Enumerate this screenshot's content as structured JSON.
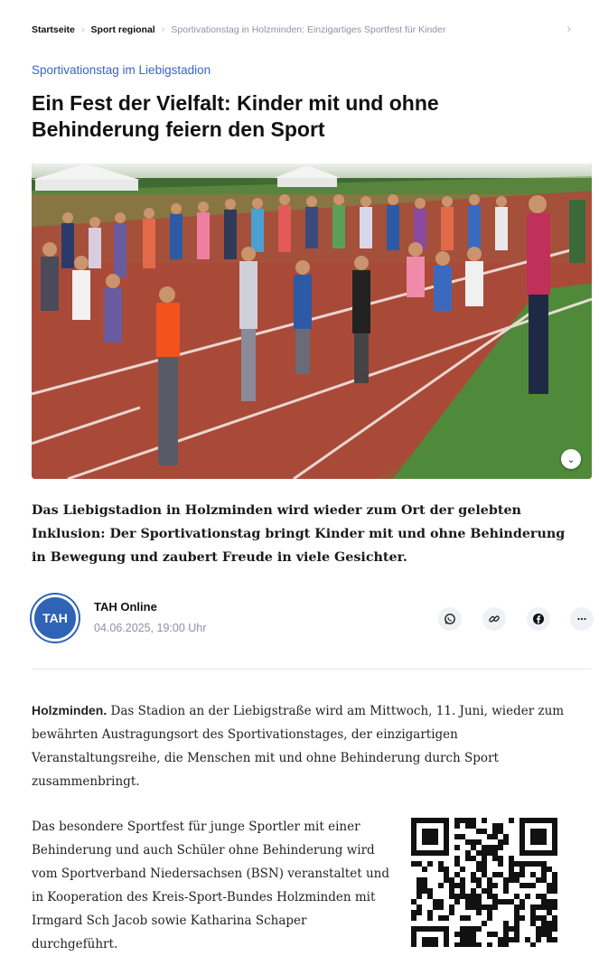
{
  "breadcrumb": {
    "items": [
      {
        "label": "Startseite"
      },
      {
        "label": "Sport regional"
      },
      {
        "label": "Sportivationstag in Holzminden: Einzigartiges Sportfest für Kinder"
      }
    ],
    "arrow_icon": "chevron-right-icon"
  },
  "article": {
    "kicker": "Sportivationstag im Liebigstadion",
    "headline": "Ein Fest der Vielfalt: Kinder mit und ohne Behinderung feiern den Sport",
    "hero_zoom_icon": "chevron-down-icon",
    "teaser": "Das Liebigstadion in Holzminden wird wieder zum Ort der gelebten Inklusion: Der Sportivationstag bringt Kinder mit und ohne Behinderung in Bewegung und zaubert Freude in viele Gesichter.",
    "author": {
      "avatar_text": "TAH",
      "name": "TAH Online",
      "date": "04.06.2025, 19:00 Uhr"
    },
    "share": [
      "whatsapp-icon",
      "link-icon",
      "facebook-icon",
      "more-icon"
    ],
    "body": {
      "dateline": "Holzminden.",
      "p1": "Das Stadion an der Liebigstraße wird am Mittwoch, 11. Juni, wieder zum bewährten Austragungsort des Sportivationstages, der einzigartigen Veranstaltungsreihe, die Menschen mit und ohne Behinderung durch Sport zusammenbringt.",
      "p2": "Das besondere Sportfest für junge Sportler mit einer Behinderung und auch Schüler ohne Behinderung wird vom Sportverband Niedersachsen (BSN) veranstaltet und in Kooperation des Kreis-Sport-Bundes Holzminden mit Irmgard Sch Jacob sowie Katharina Schaper durchgeführt."
    }
  },
  "colors": {
    "accent": "#3a63c8",
    "track": "#a94a3a",
    "grass": "#4f8a3a",
    "avatar": "#2f63b5"
  }
}
